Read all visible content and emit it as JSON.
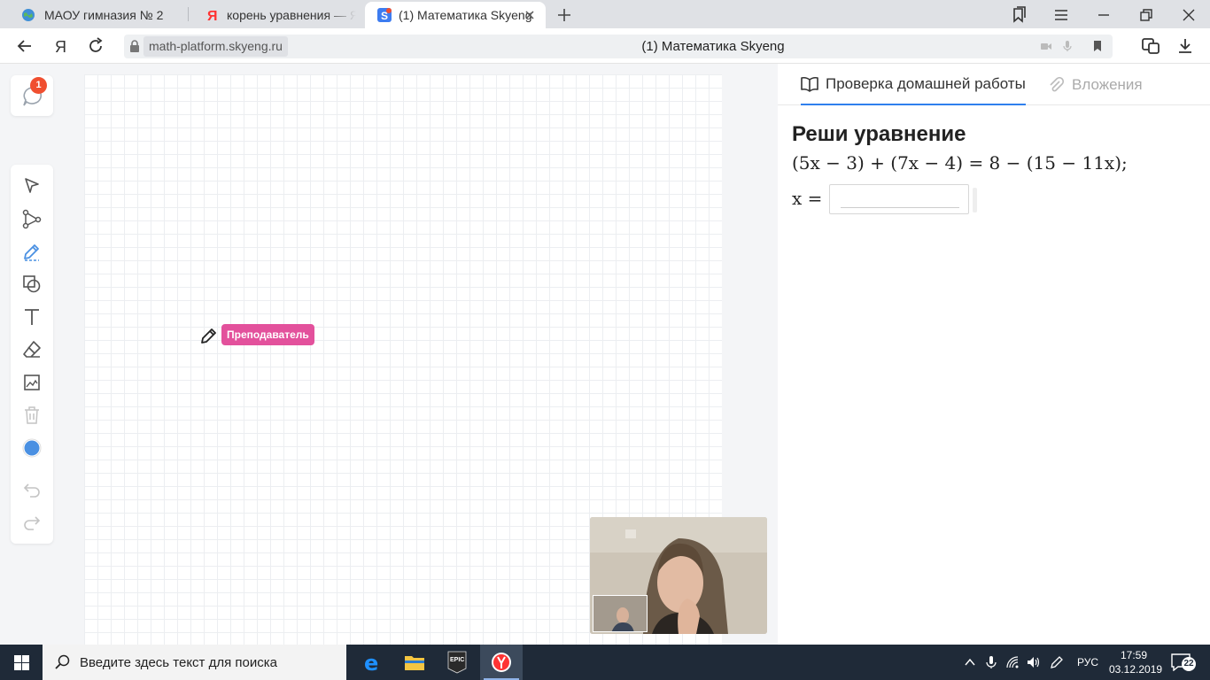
{
  "browser": {
    "tabs": [
      {
        "title": "МАОУ гимназия № 2",
        "icon": "globe-icon"
      },
      {
        "title": "корень уравнения — Яндекс",
        "icon": "yandex-icon"
      },
      {
        "title": "(1) Математика Skyeng",
        "icon": "skyeng-icon",
        "active": true
      }
    ],
    "address_host": "math-platform.skyeng.ru",
    "page_title": "(1) Математика Skyeng"
  },
  "app": {
    "chat_unread": "1",
    "tools": [
      "select-icon",
      "line-icon",
      "pen-icon",
      "shapes-icon",
      "text-icon",
      "eraser-icon",
      "image-icon",
      "trash-icon",
      "color-icon",
      "undo-icon",
      "redo-icon"
    ],
    "active_tool": "pen-icon",
    "active_color": "#4a90e2",
    "teacher_cursor_label": "Преподаватель",
    "teacher_cursor_color": "#e3519c"
  },
  "panel": {
    "tab_active": "Проверка домашней работы",
    "tab_inactive": "Вложения",
    "task_title": "Реши уравнение",
    "equation": "(5x − 3) + (7x − 4) = 8 − (15 − 11x);",
    "variable_label": "x =",
    "answer_value": ""
  },
  "taskbar": {
    "search_placeholder": "Введите здесь текст для поиска",
    "language": "РУС",
    "time": "17:59",
    "date": "03.12.2019",
    "notifications": "22"
  }
}
